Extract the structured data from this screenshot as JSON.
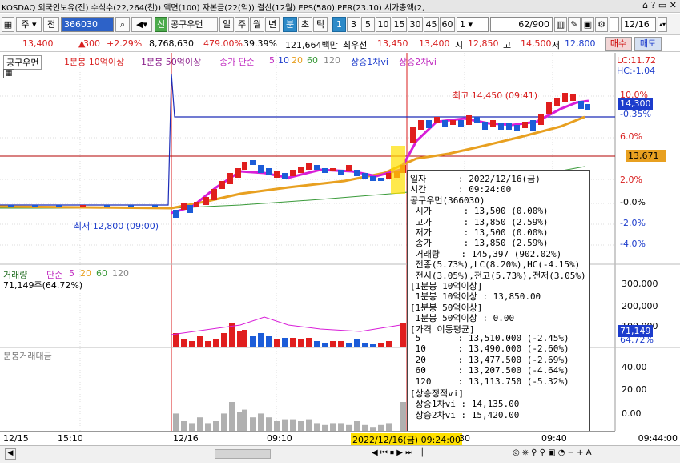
{
  "titlebar": {
    "text": "KOSDAQ 외국인보유(전) 수식수(22,264(천)) 액면(100) 자본금(22(억)) 결산(12월) EPS(580) PER(23.10) 시가총액(2,"
  },
  "toolbar": {
    "market": "주",
    "prev": "전",
    "code": "366030",
    "badge": "신",
    "name": "공구우먼",
    "periods": [
      "일",
      "주",
      "월",
      "년",
      "분",
      "초",
      "틱"
    ],
    "active_period": "분",
    "intervals": [
      "1",
      "3",
      "5",
      "10",
      "15",
      "30",
      "45",
      "60"
    ],
    "active_interval": "1",
    "count": "1",
    "display": "62/900",
    "date": "12/16"
  },
  "pricebar": {
    "price": "13,400",
    "change": "300",
    "pct": "+2.29%",
    "volume": "8,768,630",
    "vol_pct": "479.00%",
    "rate": "39.39%",
    "amount": "121,664백만",
    "best_label": "최우선",
    "bid": "13,450",
    "ask": "13,400",
    "open_label": "시",
    "open": "12,850",
    "high_label": "고",
    "high": "14,500",
    "low_label": "저",
    "low": "12,800",
    "buy": "매수",
    "sell": "매도"
  },
  "chart": {
    "legend": {
      "name": "공구우먼",
      "ma10": "1분봉 10억이상",
      "ma50": "1분봉 50억이상",
      "ma_label": "종가 단순",
      "ma_periods": [
        "5",
        "10",
        "20",
        "60",
        "120"
      ],
      "vi1": "상승1차vi",
      "vi2": "상승2차vi"
    },
    "lc": "LC:11.72",
    "hc": "HC:-1.04",
    "y_labels": [
      "10.0%",
      "14,300",
      "-0.35%",
      "6.0%",
      "13,671",
      "2.0%",
      "-0.0%",
      "-2.0%",
      "-4.0%"
    ],
    "high_annot": "최고 14,450 (09:41)",
    "low_annot": "최저 12,800 (09:00)",
    "volume_legend": {
      "title": "거래량",
      "ma_label": "단순",
      "periods": [
        "5",
        "20",
        "60",
        "120"
      ],
      "value": "71,149주(64.72%)"
    },
    "vol_y": [
      "300,000",
      "200,000",
      "100,000",
      "71,149",
      "64.72%"
    ],
    "amt_legend": "분봉거래대금",
    "amt_y": [
      "40.00",
      "20.00",
      "0.00"
    ],
    "x_labels": [
      "12/15",
      "15:10",
      "12/16",
      "09:10",
      "2022/12/16(금) 09:24:00",
      "30",
      "09:40",
      "09:44:00"
    ]
  },
  "popup": {
    "lines": [
      "일자      : 2022/12/16(금)",
      "시간      : 09:24:00",
      "공구우먼(366030)",
      " 시가      : 13,500 (0.00%)",
      " 고가      : 13,850 (2.59%)",
      " 저가      : 13,500 (0.00%)",
      " 종가      : 13,850 (2.59%)",
      " 거래량    : 145,397 (902.02%)",
      " 전종(5.73%),LC(8.20%),HC(-4.15%)",
      " 전시(3.05%),전고(5.73%),전저(3.05%)",
      "[1분봉 10억이상]",
      " 1분봉 10억이상 : 13,850.00",
      "[1분봉 50억이상]",
      " 1분봉 50억이상 : 0.00",
      "[가격 이동평균]",
      " 5       : 13,510.000 (-2.45%)",
      " 10      : 13,490.000 (-2.60%)",
      " 20      : 13,477.500 (-2.69%)",
      " 60      : 13,207.500 (-4.64%)",
      " 120     : 13,113.750 (-5.32%)",
      "[상승정적vi]",
      " 상승1차vi : 14,135.00",
      " 상승2차vi : 15,420.00"
    ]
  }
}
